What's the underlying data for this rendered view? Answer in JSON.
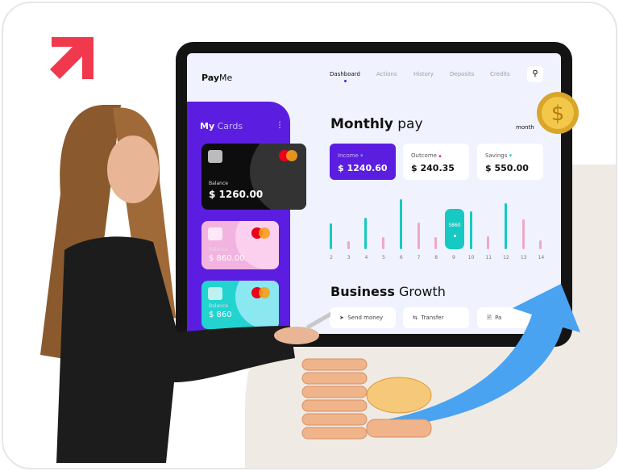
{
  "app": {
    "brand_bold": "Pay",
    "brand_light": "Me"
  },
  "nav": {
    "items": [
      {
        "label": "Dashboard",
        "active": true
      },
      {
        "label": "Actions"
      },
      {
        "label": "History"
      },
      {
        "label": "Deposits"
      },
      {
        "label": "Credits"
      }
    ],
    "search_icon": "search-icon"
  },
  "cards": {
    "title_bold": "My",
    "title_light": "Cards",
    "items": [
      {
        "label": "Balance",
        "value": "$ 1260.00",
        "color": "#111111"
      },
      {
        "label": "Balance",
        "value": "$ 860.00",
        "color": "#f3b3e0"
      },
      {
        "label": "Balance",
        "value": "$ 860",
        "color": "#22d3d0"
      }
    ],
    "brand": "mastercard"
  },
  "main": {
    "title_bold": "Monthly",
    "title_light": "pay",
    "period": "month",
    "stats": [
      {
        "label": "Income",
        "value": "$ 1240.60",
        "trend": "down"
      },
      {
        "label": "Outcome",
        "value": "$ 240.35",
        "trend": "up"
      },
      {
        "label": "Savings",
        "value": "$ 550.00",
        "trend": "down"
      }
    ],
    "highlight": {
      "label": "5860",
      "x": "9"
    },
    "section_bold": "Business",
    "section_light": "Growth",
    "actions": [
      {
        "label": "Send money"
      },
      {
        "label": "Transfer"
      },
      {
        "label": "Pa"
      }
    ]
  },
  "chart_data": {
    "type": "bar",
    "categories": [
      "2",
      "3",
      "4",
      "5",
      "6",
      "7",
      "8",
      "9",
      "10",
      "11",
      "12",
      "13",
      "14"
    ],
    "values": [
      32,
      10,
      39,
      15,
      62,
      33,
      15,
      null,
      47,
      16,
      57,
      37,
      11
    ],
    "series_colors": {
      "teal": "#16c9c2",
      "pink": "#f1a7c6"
    },
    "bar_colors": [
      "teal",
      "pink",
      "teal",
      "pink",
      "teal",
      "pink",
      "pink",
      "teal",
      "teal",
      "pink",
      "teal",
      "pink",
      "pink"
    ]
  },
  "colors": {
    "accent": "#5b1ee0",
    "logo": "#f0394d",
    "arrow": "#4aa3f0"
  }
}
